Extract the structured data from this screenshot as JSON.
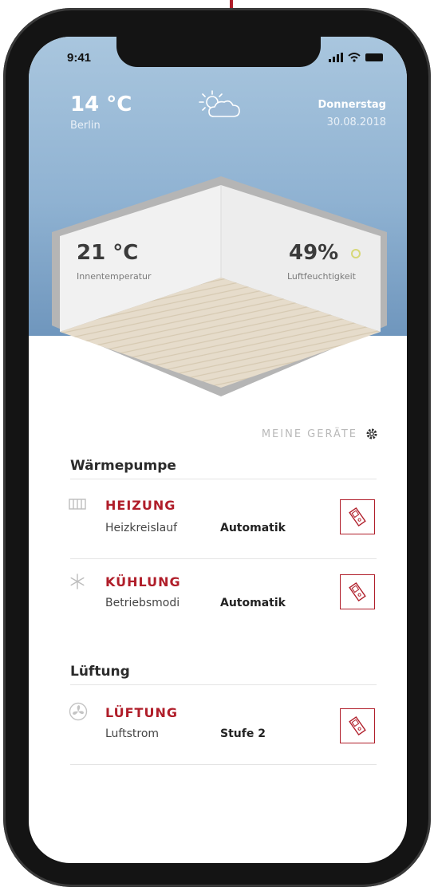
{
  "status_bar": {
    "time": "9:41"
  },
  "weather": {
    "temperature": "14 °C",
    "city": "Berlin",
    "icon": "sun-cloud-icon",
    "day": "Donnerstag",
    "date": "30.08.2018"
  },
  "room": {
    "indoor_temperature": "21 °C",
    "indoor_temperature_label": "Innentemperatur",
    "humidity": "49%",
    "humidity_label": "Luftfeuchtigkeit"
  },
  "devices_header": {
    "label": "MEINE GERÄTE",
    "icon": "gear-icon"
  },
  "sections": [
    {
      "title": "Wärmepumpe",
      "devices": [
        {
          "title": "HEIZUNG",
          "param": "Heizkreislauf",
          "value": "Automatik",
          "icon": "radiator-icon",
          "action_icon": "eco-icon"
        },
        {
          "title": "KÜHLUNG",
          "param": "Betriebsmodi",
          "value": "Automatik",
          "icon": "snowflake-icon",
          "action_icon": "eco-icon"
        }
      ]
    },
    {
      "title": "Lüftung",
      "devices": [
        {
          "title": "LÜFTUNG",
          "param": "Luftstrom",
          "value": "Stufe 2",
          "icon": "fan-icon",
          "action_icon": "eco-icon"
        }
      ]
    }
  ],
  "colors": {
    "accent": "#b01e2a",
    "sky_top": "#a9c6de",
    "sky_bottom": "#6f96bd",
    "humidity_indicator": "#d7d878"
  }
}
